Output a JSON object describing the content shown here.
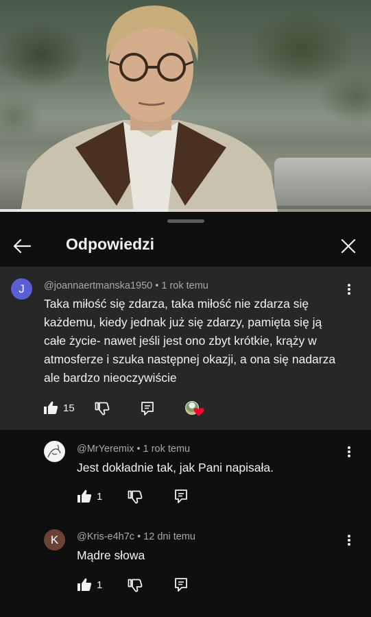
{
  "video": {
    "progress_fraction": 0.37
  },
  "panel": {
    "title": "Odpowiedzi"
  },
  "main_comment": {
    "avatar_letter": "J",
    "avatar_color": "#5c5ed6",
    "author": "@joannaertmanska1950",
    "separator": "•",
    "time": "1 rok temu",
    "text": "Taka miłość się zdarza, taka miłość nie zdarza się każdemu,  kiedy jednak już się zdarzy, pamięta się ją całe życie- nawet jeśli jest ono zbyt krótkie,  krąży w atmosferze i szuka następnej okazji, a ona się nadarza ale bardzo nieoczywiście",
    "likes": "15"
  },
  "replies": [
    {
      "avatar_letter": "",
      "author": "@MrYeremix",
      "separator": "•",
      "time": "1 rok temu",
      "text": "Jest dokładnie tak, jak Pani napisała.",
      "likes": "1"
    },
    {
      "avatar_letter": "K",
      "avatar_color": "#6b4336",
      "author": "@Kris-e4h7c",
      "separator": "•",
      "time": "12 dni temu",
      "text": "Mądre słowa",
      "likes": "1"
    }
  ],
  "icons": {
    "back": "arrow-left-icon",
    "close": "close-icon",
    "more": "three-dots-vertical-icon",
    "like": "thumbs-up-icon",
    "dislike": "thumbs-down-icon",
    "reply": "reply-comment-icon",
    "heart": "creator-heart-icon"
  },
  "colors": {
    "heart": "#ff0033",
    "panel_bg": "#0f0f0f",
    "highlight_bg": "#272727"
  }
}
